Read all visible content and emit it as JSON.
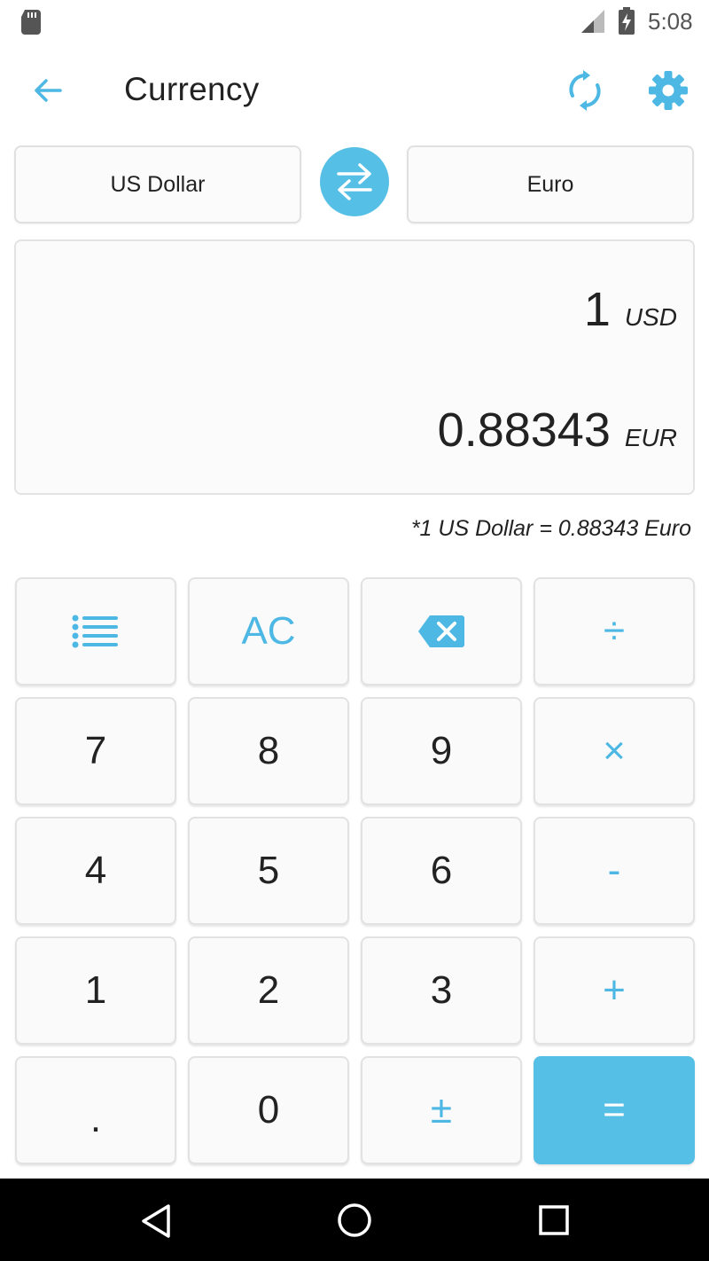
{
  "status_bar": {
    "time": "5:08"
  },
  "header": {
    "title": "Currency",
    "icons": {
      "back": "arrow-left-icon",
      "refresh": "refresh-icon",
      "settings": "gear-icon"
    }
  },
  "selectors": {
    "from": "US Dollar",
    "to": "Euro",
    "swap_icon": "swap-arrows-icon"
  },
  "display": {
    "input_value": "1",
    "input_code": "USD",
    "output_value": "0.88343",
    "output_code": "EUR"
  },
  "rate_note": "*1 US Dollar = 0.88343 Euro",
  "keypad": {
    "row1": {
      "list_icon": "list-icon",
      "ac": "AC",
      "backspace_icon": "backspace-icon",
      "divide": "÷"
    },
    "row2": {
      "k7": "7",
      "k8": "8",
      "k9": "9",
      "multiply": "×"
    },
    "row3": {
      "k4": "4",
      "k5": "5",
      "k6": "6",
      "minus": "-"
    },
    "row4": {
      "k1": "1",
      "k2": "2",
      "k3": "3",
      "plus": "+"
    },
    "row5": {
      "dot": ".",
      "k0": "0",
      "plusminus": "±",
      "equals": "="
    }
  },
  "colors": {
    "accent": "#55bfe6",
    "text": "#222222",
    "border": "#e2e2e2"
  }
}
